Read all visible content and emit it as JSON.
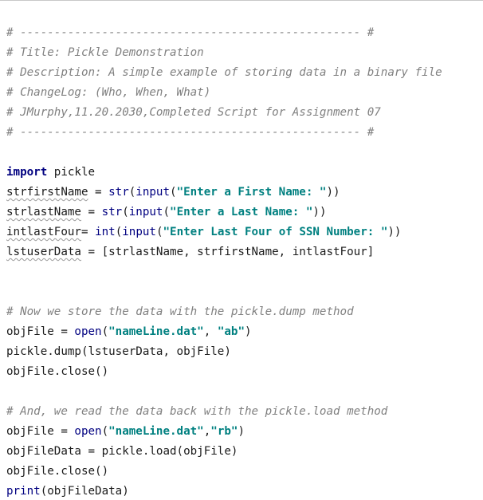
{
  "code": {
    "header": {
      "rule_top": "# -------------------------------------------------- #",
      "title": "# Title: Pickle Demonstration",
      "description": "# Description: A simple example of storing data in a binary file",
      "changelog": "# ChangeLog: (Who, When, What)",
      "entry": "# JMurphy,11.20.2030,Completed Script for Assignment 07",
      "rule_bottom": "# -------------------------------------------------- #"
    },
    "l_import": {
      "kw": "import",
      "rest": " pickle"
    },
    "l_first": {
      "var": "strfirstName",
      "eq": " = ",
      "fn1": "str",
      "p1": "(",
      "fn2": "input",
      "p2": "(",
      "str": "\"Enter a First Name: \"",
      "close": "))"
    },
    "l_last": {
      "var": "strlastName",
      "eq": " = ",
      "fn1": "str",
      "p1": "(",
      "fn2": "input",
      "p2": "(",
      "str": "\"Enter a Last Name: \"",
      "close": "))"
    },
    "l_four": {
      "var": "intlastFour",
      "eq": "= ",
      "fn1": "int",
      "p1": "(",
      "fn2": "input",
      "p2": "(",
      "str": "\"Enter Last Four of SSN Number: \"",
      "close": "))"
    },
    "l_list": {
      "var": "lstuserData",
      "rest": " = [strlastName, strfirstName, intlastFour]"
    },
    "c_store": "# Now we store the data with the pickle.dump method",
    "l_open_ab": {
      "pre": "objFile = ",
      "fn": "open",
      "p": "(",
      "s1": "\"nameLine.dat\"",
      "mid": ", ",
      "s2": "\"ab\"",
      "close": ")"
    },
    "l_dump": "pickle.dump(lstuserData, objFile)",
    "l_close1": "objFile.close()",
    "c_read": "# And, we read the data back with the pickle.load method",
    "l_open_rb": {
      "pre": "objFile = ",
      "fn": "open",
      "p": "(",
      "s1": "\"nameLine.dat\"",
      "mid": ",",
      "s2": "\"rb\"",
      "close": ")"
    },
    "l_load": "objFileData = pickle.load(objFile)",
    "l_close2": "objFile.close()",
    "l_print": {
      "fn": "print",
      "rest": "(objFileData)"
    }
  }
}
